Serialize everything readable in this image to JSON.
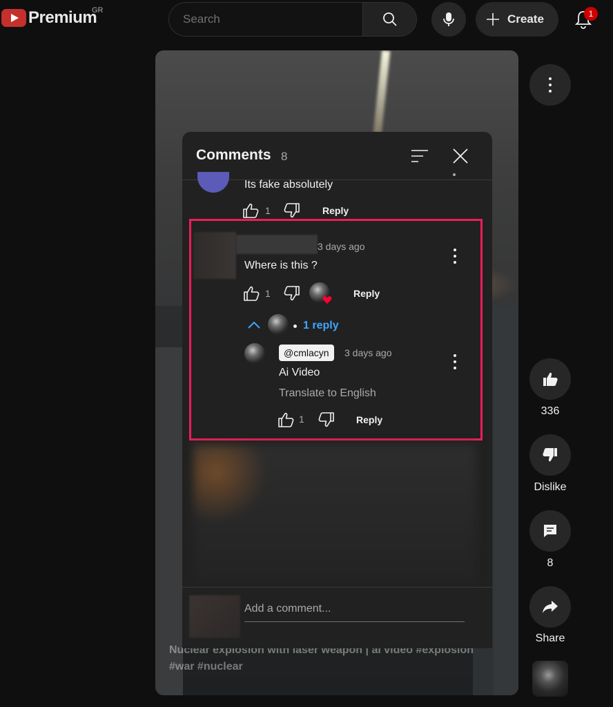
{
  "header": {
    "logo_text": "Premium",
    "region": "GR",
    "search_placeholder": "Search",
    "create_label": "Create",
    "notification_count": "1"
  },
  "video": {
    "caption": "Nuclear explosion with laser weapon | ai video #explosion #war #nuclear"
  },
  "comments_panel": {
    "title": "Comments",
    "count": "8",
    "comments": [
      {
        "text": "Its fake absolutely",
        "likes": "1",
        "reply_label": "Reply"
      },
      {
        "time": "3 days ago",
        "text": "Where is this ?",
        "likes": "1",
        "reply_label": "Reply",
        "replies_toggle": "1 reply",
        "replies": [
          {
            "author": "@cmlacyn",
            "time": "3 days ago",
            "text": "Ai Video",
            "translate_label": "Translate to English",
            "likes": "1",
            "reply_label": "Reply"
          }
        ]
      }
    ],
    "add_comment_placeholder": "Add a comment..."
  },
  "actions": {
    "like_count": "336",
    "dislike_label": "Dislike",
    "comments_count": "8",
    "share_label": "Share"
  },
  "colors": {
    "highlight": "#ee1d5a",
    "link": "#3ea6ff",
    "brand_red": "#c4302b"
  },
  "icons": [
    "search-icon",
    "mic-icon",
    "plus-icon",
    "bell-icon",
    "kebab-icon",
    "sort-icon",
    "close-icon",
    "thumb-up-icon",
    "thumb-down-icon",
    "heart-icon",
    "chevron-up-icon",
    "comment-icon",
    "share-icon"
  ]
}
